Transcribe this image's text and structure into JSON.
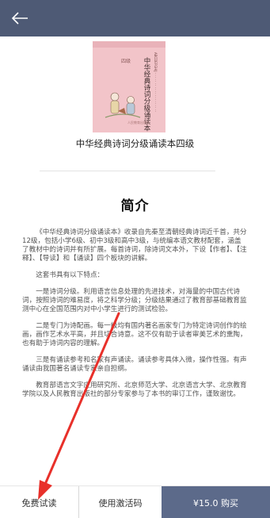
{
  "header": {
    "back_icon": "back-arrow-icon",
    "background": "#4e5a75"
  },
  "book": {
    "title": "中华经典诗词分级诵读本四级",
    "cover": {
      "title_vertical": "中华经典诗词分级诵读本",
      "badge": "四级",
      "color": "#f2c4c9"
    }
  },
  "intro": {
    "heading": "简介",
    "paragraphs": [
      "《中华经典诗词分级诵读本》收录自先秦至清朝经典诗词近千首，共分12级，包括小学6级、初中3级和高中3级，与统编本语文教材配套，涵盖了教材中的诗词并有所扩展。每首诗词，除诗词文本外，下设【作者】、【注释】、【导读】和【诵读】四个板块的讲解。",
      "这套书具有以下特点：",
      "一是诗词分级。利用语言信息处理的先进技术，对海量的中国古代诗词，按照诗词的难易度，将之科学分级；分级结果通过了教育部基础教育监测中心在全国范围内对中小学生进行的测试检验。",
      "二是专门为诗配画。每一级均有国内著名画家专门为特定诗词创作的绘画，画作艺术水平高，并且切合诗意。这不仅有助于读者审美艺术的熏陶，也有助于诗词内容的理解。",
      "三是有诵读参考和名家有声诵读。诵读参考具体入微，操作性强。有声诵读由我国著名诵读专家亲自担纲。",
      "教育部语言文字应用研究所、北京师范大学、北京语言大学、北京教育学院以及人民教育出版社的部分专家参与了本书的审订工作，谨致谢忱。"
    ]
  },
  "bottom_bar": {
    "trial_label": "免费试读",
    "activation_label": "使用激活码",
    "buy_label": "¥15.0  购买",
    "buy_color": "#5c6a8a"
  },
  "annotation": {
    "arrow_color": "#e8302a"
  }
}
